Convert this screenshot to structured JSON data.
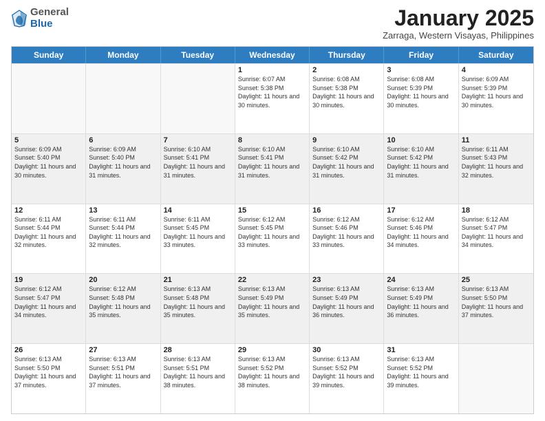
{
  "header": {
    "logo_general": "General",
    "logo_blue": "Blue",
    "month_title": "January 2025",
    "location": "Zarraga, Western Visayas, Philippines"
  },
  "days_of_week": [
    "Sunday",
    "Monday",
    "Tuesday",
    "Wednesday",
    "Thursday",
    "Friday",
    "Saturday"
  ],
  "weeks": [
    [
      {
        "day": "",
        "empty": true
      },
      {
        "day": "",
        "empty": true
      },
      {
        "day": "",
        "empty": true
      },
      {
        "day": "1",
        "sunrise": "6:07 AM",
        "sunset": "5:38 PM",
        "daylight": "11 hours and 30 minutes."
      },
      {
        "day": "2",
        "sunrise": "6:08 AM",
        "sunset": "5:38 PM",
        "daylight": "11 hours and 30 minutes."
      },
      {
        "day": "3",
        "sunrise": "6:08 AM",
        "sunset": "5:39 PM",
        "daylight": "11 hours and 30 minutes."
      },
      {
        "day": "4",
        "sunrise": "6:09 AM",
        "sunset": "5:39 PM",
        "daylight": "11 hours and 30 minutes."
      }
    ],
    [
      {
        "day": "5",
        "sunrise": "6:09 AM",
        "sunset": "5:40 PM",
        "daylight": "11 hours and 30 minutes."
      },
      {
        "day": "6",
        "sunrise": "6:09 AM",
        "sunset": "5:40 PM",
        "daylight": "11 hours and 31 minutes."
      },
      {
        "day": "7",
        "sunrise": "6:10 AM",
        "sunset": "5:41 PM",
        "daylight": "11 hours and 31 minutes."
      },
      {
        "day": "8",
        "sunrise": "6:10 AM",
        "sunset": "5:41 PM",
        "daylight": "11 hours and 31 minutes."
      },
      {
        "day": "9",
        "sunrise": "6:10 AM",
        "sunset": "5:42 PM",
        "daylight": "11 hours and 31 minutes."
      },
      {
        "day": "10",
        "sunrise": "6:10 AM",
        "sunset": "5:42 PM",
        "daylight": "11 hours and 31 minutes."
      },
      {
        "day": "11",
        "sunrise": "6:11 AM",
        "sunset": "5:43 PM",
        "daylight": "11 hours and 32 minutes."
      }
    ],
    [
      {
        "day": "12",
        "sunrise": "6:11 AM",
        "sunset": "5:44 PM",
        "daylight": "11 hours and 32 minutes."
      },
      {
        "day": "13",
        "sunrise": "6:11 AM",
        "sunset": "5:44 PM",
        "daylight": "11 hours and 32 minutes."
      },
      {
        "day": "14",
        "sunrise": "6:11 AM",
        "sunset": "5:45 PM",
        "daylight": "11 hours and 33 minutes."
      },
      {
        "day": "15",
        "sunrise": "6:12 AM",
        "sunset": "5:45 PM",
        "daylight": "11 hours and 33 minutes."
      },
      {
        "day": "16",
        "sunrise": "6:12 AM",
        "sunset": "5:46 PM",
        "daylight": "11 hours and 33 minutes."
      },
      {
        "day": "17",
        "sunrise": "6:12 AM",
        "sunset": "5:46 PM",
        "daylight": "11 hours and 34 minutes."
      },
      {
        "day": "18",
        "sunrise": "6:12 AM",
        "sunset": "5:47 PM",
        "daylight": "11 hours and 34 minutes."
      }
    ],
    [
      {
        "day": "19",
        "sunrise": "6:12 AM",
        "sunset": "5:47 PM",
        "daylight": "11 hours and 34 minutes."
      },
      {
        "day": "20",
        "sunrise": "6:12 AM",
        "sunset": "5:48 PM",
        "daylight": "11 hours and 35 minutes."
      },
      {
        "day": "21",
        "sunrise": "6:13 AM",
        "sunset": "5:48 PM",
        "daylight": "11 hours and 35 minutes."
      },
      {
        "day": "22",
        "sunrise": "6:13 AM",
        "sunset": "5:49 PM",
        "daylight": "11 hours and 35 minutes."
      },
      {
        "day": "23",
        "sunrise": "6:13 AM",
        "sunset": "5:49 PM",
        "daylight": "11 hours and 36 minutes."
      },
      {
        "day": "24",
        "sunrise": "6:13 AM",
        "sunset": "5:49 PM",
        "daylight": "11 hours and 36 minutes."
      },
      {
        "day": "25",
        "sunrise": "6:13 AM",
        "sunset": "5:50 PM",
        "daylight": "11 hours and 37 minutes."
      }
    ],
    [
      {
        "day": "26",
        "sunrise": "6:13 AM",
        "sunset": "5:50 PM",
        "daylight": "11 hours and 37 minutes."
      },
      {
        "day": "27",
        "sunrise": "6:13 AM",
        "sunset": "5:51 PM",
        "daylight": "11 hours and 37 minutes."
      },
      {
        "day": "28",
        "sunrise": "6:13 AM",
        "sunset": "5:51 PM",
        "daylight": "11 hours and 38 minutes."
      },
      {
        "day": "29",
        "sunrise": "6:13 AM",
        "sunset": "5:52 PM",
        "daylight": "11 hours and 38 minutes."
      },
      {
        "day": "30",
        "sunrise": "6:13 AM",
        "sunset": "5:52 PM",
        "daylight": "11 hours and 39 minutes."
      },
      {
        "day": "31",
        "sunrise": "6:13 AM",
        "sunset": "5:52 PM",
        "daylight": "11 hours and 39 minutes."
      },
      {
        "day": "",
        "empty": true
      }
    ]
  ]
}
